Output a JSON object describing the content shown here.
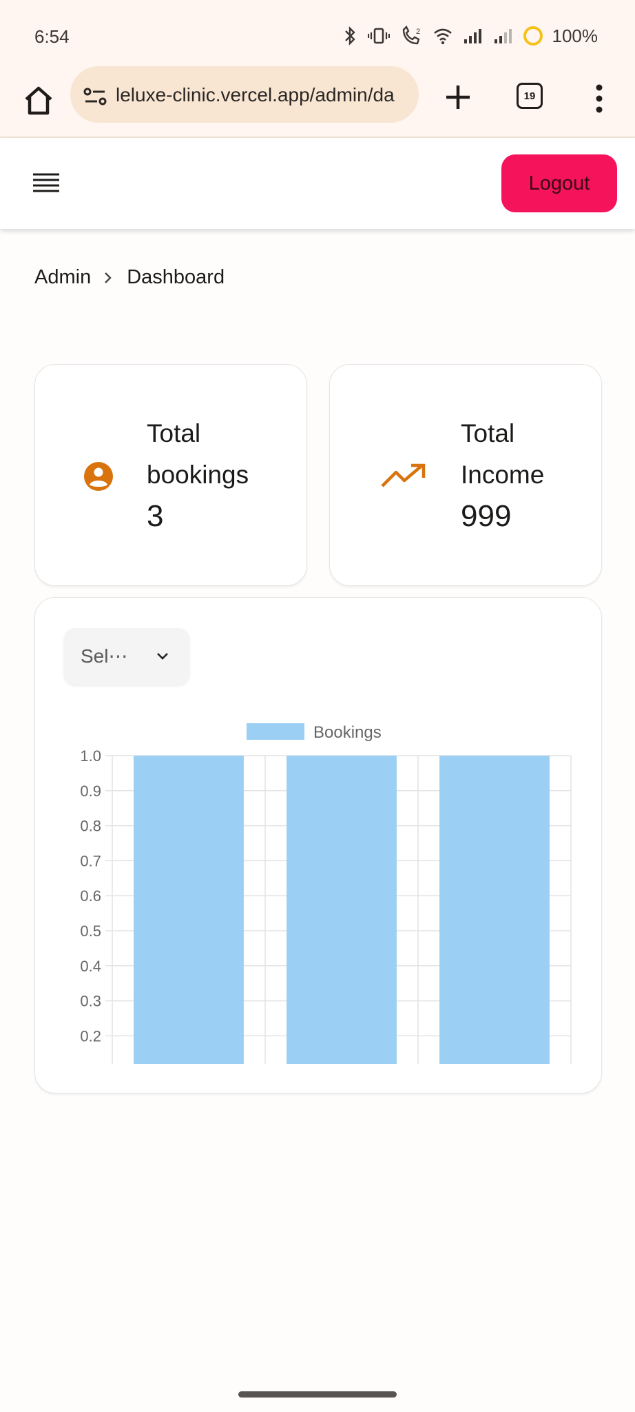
{
  "status_bar": {
    "time": "6:54",
    "battery": "100%",
    "icons": [
      "bluetooth-icon",
      "vibrate-icon",
      "wifi-call-icon",
      "wifi-icon",
      "signal-icon",
      "signal-weak-icon",
      "battery-saver-icon"
    ]
  },
  "browser": {
    "url": "leluxe-clinic.vercel.app/admin/da",
    "tab_count": "19"
  },
  "header": {
    "logout_label": "Logout"
  },
  "breadcrumb": {
    "root": "Admin",
    "current": "Dashboard"
  },
  "stats": {
    "bookings": {
      "label_line1": "Total",
      "label_line2": "bookings",
      "value": "3",
      "icon": "user-circle-icon"
    },
    "income": {
      "label_line1": "Total",
      "label_line2": "Income",
      "value": "999",
      "icon": "trending-up-icon"
    }
  },
  "filter": {
    "select_label": "Sel⋯"
  },
  "colors": {
    "accent_logout": "#f5135c",
    "stat_icon": "#d9730d",
    "bar_fill": "#9bcff3"
  },
  "chart_data": {
    "type": "bar",
    "categories": [
      "",
      "",
      ""
    ],
    "series": [
      {
        "name": "Bookings",
        "values": [
          1,
          1,
          1
        ]
      }
    ],
    "yticks": [
      "1.0",
      "0.9",
      "0.8",
      "0.7",
      "0.6",
      "0.5",
      "0.4",
      "0.3",
      "0.2"
    ],
    "ylim": [
      0.12,
      1.0
    ],
    "grid": true,
    "legend": "top-center"
  }
}
